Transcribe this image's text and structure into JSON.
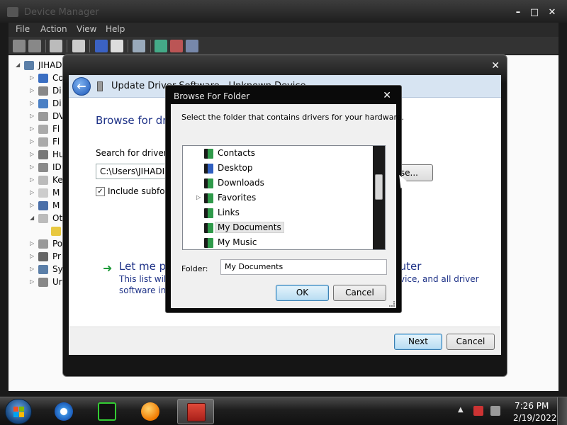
{
  "device_manager": {
    "title": "Device Manager",
    "menu": [
      "File",
      "Action",
      "View",
      "Help"
    ],
    "root": "JIHADI",
    "tree_items": [
      "Co",
      "Di",
      "Di",
      "DV",
      "Fl",
      "Fl",
      "Hu",
      "ID",
      "Ke",
      "M",
      "M",
      "Ot",
      "",
      "Po",
      "Pr",
      "Sy",
      "Ur"
    ]
  },
  "update_driver": {
    "title": "Update Driver Software - Unknown Device",
    "heading": "Browse for driver software on your computer",
    "search_label": "Search for driver software in this location:",
    "path_value": "C:\\Users\\JIHADI JOBS",
    "browse_label": "Browse...",
    "include_subfolders_label": "Include subfolders",
    "include_subfolders_checked": "✓",
    "let_me_pick": "Let me pick from a list of device drivers on my computer",
    "description_line1": "This list will show installed driver software compatible with the device, and all driver",
    "description_line2": "software in the same category as the device.",
    "description_tail": "ll driver",
    "next_label": "Next",
    "cancel_label": "Cancel"
  },
  "browse_folder": {
    "title": "Browse For Folder",
    "instruction": "Select the folder that contains drivers for your hardware.",
    "items": [
      {
        "label": "Contacts",
        "has_children": false
      },
      {
        "label": "Desktop",
        "has_children": false
      },
      {
        "label": "Downloads",
        "has_children": false
      },
      {
        "label": "Favorites",
        "has_children": true
      },
      {
        "label": "Links",
        "has_children": false
      },
      {
        "label": "My Documents",
        "has_children": false,
        "selected": true
      },
      {
        "label": "My Music",
        "has_children": false
      }
    ],
    "folder_label": "Folder:",
    "folder_value": "My Documents",
    "ok_label": "OK",
    "cancel_label": "Cancel"
  },
  "taskbar": {
    "apps": [
      "internet-explorer-icon",
      "device-manager-icon",
      "media-player-icon",
      "toolbox-icon"
    ],
    "active_app": "toolbox-icon",
    "clock_time": "7:26 PM",
    "clock_date": "2/19/2022"
  }
}
